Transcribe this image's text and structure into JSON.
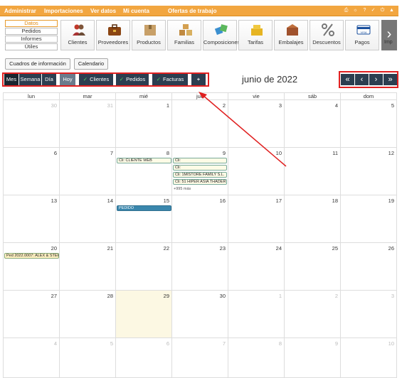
{
  "topbar": {
    "menu": [
      "Administrar",
      "Importaciones",
      "Ver datos",
      "Mi cuenta",
      "Ofertas de trabajo"
    ]
  },
  "sections": [
    "Datos",
    "Pedidos",
    "Informes",
    "Útiles"
  ],
  "modules": [
    "Clientes",
    "Proveedores",
    "Productos",
    "Familias",
    "Composiciones",
    "Tarifas",
    "Embalajes",
    "Descuentos",
    "Pagos",
    "Imp"
  ],
  "buttons": {
    "info": "Cuadros de información",
    "calendar": "Calendario"
  },
  "toolbar": {
    "views": [
      "Mes",
      "Semana",
      "Día"
    ],
    "today": "Hoy",
    "filters": [
      "Clientes",
      "Pedidos",
      "Facturas"
    ],
    "check": "✓",
    "plus": "+"
  },
  "nav": [
    "«",
    "‹",
    "›",
    "»"
  ],
  "calendar": {
    "title": "junio de 2022",
    "weekdays": [
      "lun",
      "mar",
      "mié",
      "jue",
      "vie",
      "sáb",
      "dom"
    ],
    "weeks": [
      [
        "30",
        "31",
        "1",
        "2",
        "3",
        "4",
        "5"
      ],
      [
        "6",
        "7",
        "8",
        "9",
        "10",
        "11",
        "12"
      ],
      [
        "13",
        "14",
        "15",
        "16",
        "17",
        "18",
        "19"
      ],
      [
        "20",
        "21",
        "22",
        "23",
        "24",
        "25",
        "26"
      ],
      [
        "27",
        "28",
        "29",
        "30",
        "1",
        "2",
        "3"
      ],
      [
        "4",
        "5",
        "6",
        "7",
        "8",
        "9",
        "10"
      ]
    ],
    "events": {
      "w1_wed": "Cli: CLIENTE WEB",
      "w1_thu_1": "Cli:",
      "w1_thu_2": "Cli:",
      "w1_thu_3": "Cli: 1MISTORE FAMILY S.L.",
      "w1_thu_4": "Cli: 51 HIPER ASIA THADER S",
      "w1_thu_more": "+995 más",
      "w2_wed": "PEDIDO",
      "w3_mon": "Ped 2022.0007: ALEX & STEF"
    }
  }
}
